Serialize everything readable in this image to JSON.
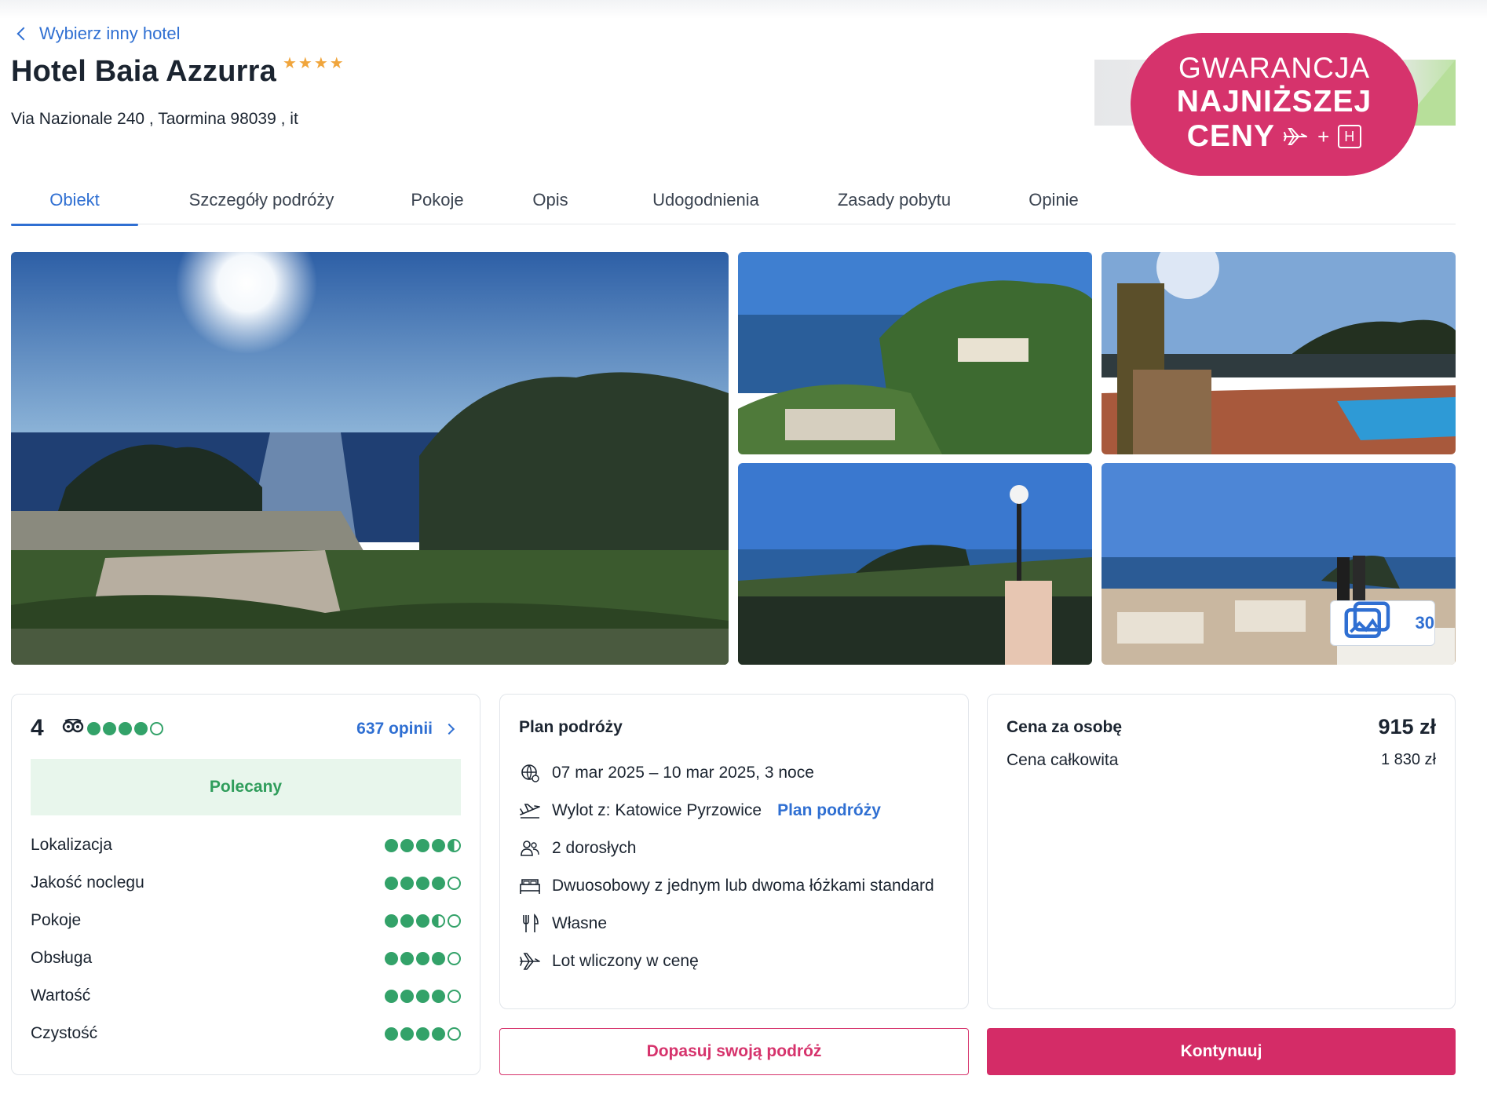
{
  "header": {
    "back_label": "Wybierz inny hotel",
    "hotel_name": "Hotel Baia Azzurra",
    "stars": 4,
    "address": "Via Nazionale 240 , Taormina 98039 , it"
  },
  "badge": {
    "line1": "GWARANCJA",
    "line2": "NAJNIŻSZEJ",
    "line3": "CENY",
    "plus": "+",
    "h": "H"
  },
  "tabs": [
    {
      "label": "Obiekt",
      "active": true
    },
    {
      "label": "Szczegóły podróży"
    },
    {
      "label": "Pokoje"
    },
    {
      "label": "Opis"
    },
    {
      "label": "Udogodnienia"
    },
    {
      "label": "Zasady pobytu"
    },
    {
      "label": "Opinie"
    }
  ],
  "gallery": {
    "photo_count": "30"
  },
  "reviews": {
    "score": "4",
    "overall_dots": 4,
    "opinions_link": "637 opinii",
    "recommended": "Polecany",
    "categories": [
      {
        "label": "Lokalizacja",
        "dots": 4.5
      },
      {
        "label": "Jakość noclegu",
        "dots": 4
      },
      {
        "label": "Pokoje",
        "dots": 3.5
      },
      {
        "label": "Obsługa",
        "dots": 4
      },
      {
        "label": "Wartość",
        "dots": 4
      },
      {
        "label": "Czystość",
        "dots": 4
      }
    ]
  },
  "plan": {
    "title": "Plan podróży",
    "dates": "07 mar 2025 – 10 mar 2025, 3 noce",
    "flight_from": "Wylot z: Katowice Pyrzowice",
    "flight_link": "Plan podróży",
    "guests": "2 dorosłych",
    "room": "Dwuosobowy z jednym lub dwoma łóżkami standard",
    "board": "Własne",
    "flight_included": "Lot wliczony w cenę"
  },
  "price": {
    "per_person_label": "Cena za osobę",
    "per_person_value": "915 zł",
    "total_label": "Cena całkowita",
    "total_value": "1 830 zł"
  },
  "buttons": {
    "customize": "Dopasuj swoją podróż",
    "continue": "Kontynuuj"
  },
  "colors": {
    "accent": "#2f6fd2",
    "brand": "#d6336c",
    "rating_green": "#33a269"
  }
}
